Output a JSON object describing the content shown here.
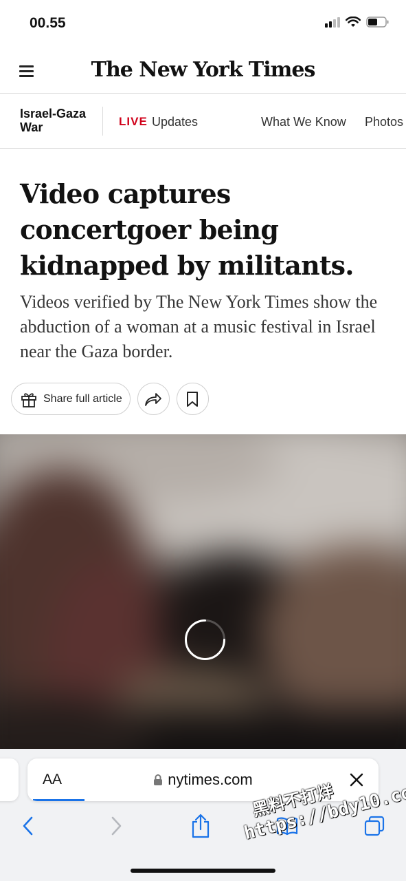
{
  "status_bar": {
    "time": "00.55"
  },
  "masthead": {
    "logo": "The New York Times",
    "menu_icon": "hamburger-menu-icon"
  },
  "section_nav": {
    "section": "Israel-Gaza War",
    "live_badge": "LIVE",
    "live_label": "Updates",
    "links": [
      "What We Know",
      "Photos"
    ]
  },
  "article": {
    "headline": "Video captures concertgoer being kidnapped by militants.",
    "summary": "Videos verified by The New York Times show the abduction of a woman at a music festival in Israel near the Gaza border.",
    "share_label": "Share full article",
    "share_icon": "gift-icon",
    "forward_icon": "share-arrow-icon",
    "bookmark_icon": "bookmark-icon"
  },
  "video": {
    "state": "loading",
    "spinner_icon": "loading-spinner-icon"
  },
  "browser": {
    "text_size_label": "AA",
    "url": "nytimes.com",
    "lock_icon": "lock-icon",
    "close_icon": "close-icon",
    "toolbar": [
      "back-icon",
      "forward-icon",
      "share-icon",
      "bookmarks-icon",
      "tabs-icon"
    ],
    "accent": "#1a73e8"
  },
  "watermark": {
    "line1": "黑料不打烊",
    "line2": "https://bdy10.co"
  }
}
